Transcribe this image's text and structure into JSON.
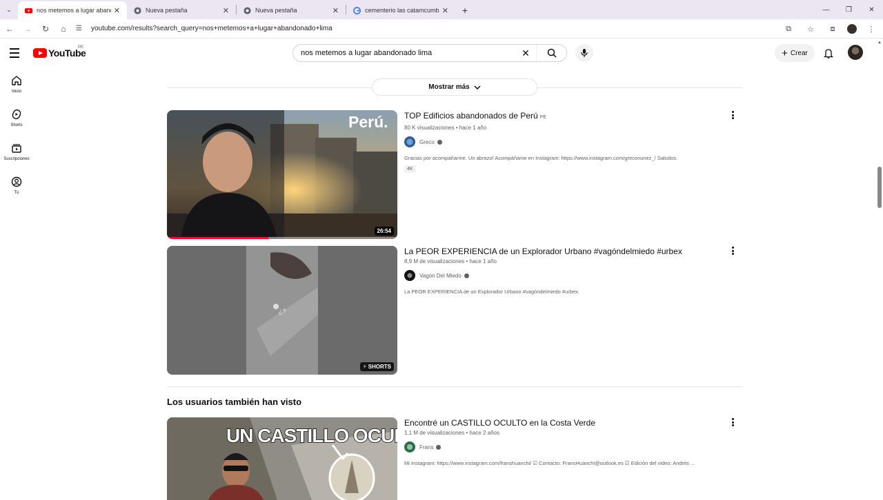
{
  "browser": {
    "tabs": [
      {
        "title": "nos metemos a lugar abandonad",
        "icon": "youtube-icon",
        "active": true
      },
      {
        "title": "Nueva pestaña",
        "icon": "chrome-icon",
        "active": false
      },
      {
        "title": "Nueva pestaña",
        "icon": "chrome-icon",
        "active": false
      },
      {
        "title": "cementerio las catamcumbas -",
        "icon": "google-icon",
        "active": false
      }
    ],
    "new_tab": "+",
    "url": "youtube.com/results?search_query=nos+metemos+a+lugar+abandonado+lima"
  },
  "youtube": {
    "logo_text": "YouTube",
    "country": "PE",
    "search_query": "nos metemos a lugar abandonado lima",
    "create_label": "Crear",
    "sidebar": [
      {
        "label": "Inicio",
        "icon": "home-icon"
      },
      {
        "label": "Shorts",
        "icon": "shorts-icon"
      },
      {
        "label": "Suscripciones",
        "icon": "subscriptions-icon"
      },
      {
        "label": "Tú",
        "icon": "you-icon"
      }
    ],
    "show_more": "Mostrar más",
    "videos": [
      {
        "title": "TOP Edificios abandonados de Perú",
        "country": "PE",
        "views": "80 K visualizaciones",
        "age": "hace 1 año",
        "channel": "Greco",
        "description": "Gracias por acompañarme. Un abrazo! Acompáñame en Instagram: https://www.instagram.com/greconunez_/ Saludos.",
        "pill": "4K",
        "duration": "26:54",
        "watched_fraction": 0.44,
        "thumb_text": "Perú."
      },
      {
        "title": "La PEOR EXPERIENCIA de un Explorador Urbano #vagóndelmiedo #urbex",
        "views": "8,9 M de visualizaciones",
        "age": "hace 1 año",
        "channel": "Vagón Del Miedo",
        "description": "La PEOR EXPERIENCIA de un Explorador Urbano #vagóndelmiedo #urbex.",
        "duration": "SHORTS"
      }
    ],
    "section_title": "Los usuarios también han visto",
    "related": [
      {
        "title": "Encontré un CASTILLO OCULTO en la Costa Verde",
        "views": "1,1 M de visualizaciones",
        "age": "hace 2 años",
        "channel": "Frans",
        "description": "Mi Instagram: https://www.instagram.com/franshuanchi/ ☑ Contacto: FransHuanchi@outlook.es ☑ Edición del video: Andrés ...",
        "thumb_text": "UN CASTILLO OCULTO"
      }
    ]
  }
}
